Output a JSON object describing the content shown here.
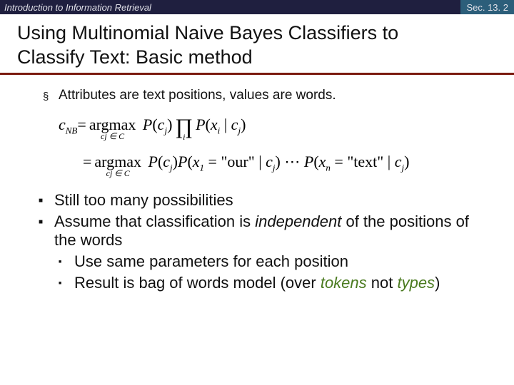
{
  "header": {
    "left": "Introduction to Information Retrieval",
    "right": "Sec. 13. 2"
  },
  "title": {
    "line1": "Using Multinomial Naive Bayes Classifiers to",
    "line2": "Classify Text: Basic method"
  },
  "bullet1": "Attributes are text positions, values are words.",
  "formula": {
    "cnb": "c",
    "cnb_sub": "NB",
    "eq1_pre": " = ",
    "argmax": "argmax",
    "argmax_sub": "cj ∈ C",
    "p_cj": "P(cj)",
    "prod_sub": "i",
    "p_xi": "P(xi | cj)",
    "eq2": "= ",
    "p_x1": "P(x1 = \"our\" | cj) ⋯ P(xn = \"text\" | cj)"
  },
  "lower": {
    "b1": "Still too many possibilities",
    "b2_pre": "Assume that classification is ",
    "b2_em": "independent",
    "b2_post": " of the positions of the words",
    "s1": "Use same parameters for each position",
    "s2_pre": "Result is bag of words model (over ",
    "s2_tok": "tokens",
    "s2_mid": " not ",
    "s2_typ": "types",
    "s2_post": ")"
  }
}
